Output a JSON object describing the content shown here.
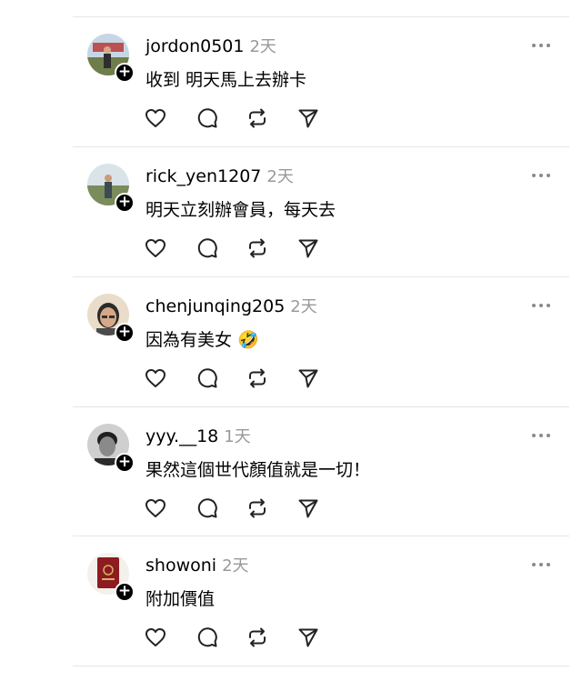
{
  "posts": [
    {
      "username": "jordon0501",
      "time": "2天",
      "text": "收到 明天馬上去辦卡",
      "avatar_icon": "photo-outdoor-avatar",
      "avatar_colors": [
        "#c7d6e4",
        "#5d6f3a",
        "#b9302e"
      ]
    },
    {
      "username": "rick_yen1207",
      "time": "2天",
      "text": "明天立刻辦會員，每天去",
      "avatar_icon": "photo-landscape-avatar",
      "avatar_colors": [
        "#d9e3e8",
        "#7a8b5c",
        "#3d4a52"
      ]
    },
    {
      "username": "chenjunqing205",
      "time": "2天",
      "text": "因為有美女 🤣",
      "avatar_icon": "photo-face-avatar",
      "avatar_colors": [
        "#e9dcc9",
        "#d6a888",
        "#2c2a28"
      ]
    },
    {
      "username": "yyy.__18",
      "time": "1天",
      "text": "果然這個世代顏值就是一切！",
      "avatar_icon": "photo-face-bw-avatar",
      "avatar_colors": [
        "#cfcfcf",
        "#8a8a8a",
        "#1f1f1f"
      ]
    },
    {
      "username": "showoni",
      "time": "2天",
      "text": "附加價值",
      "avatar_icon": "passport-avatar",
      "avatar_colors": [
        "#f4f1ec",
        "#8e1b1f",
        "#d4b26a"
      ]
    }
  ],
  "icons": {
    "like": "heart-icon",
    "reply": "comment-icon",
    "repost": "repost-icon",
    "share": "send-icon",
    "more": "more-icon",
    "follow": "follow-plus-icon"
  },
  "follow_symbol": "+"
}
